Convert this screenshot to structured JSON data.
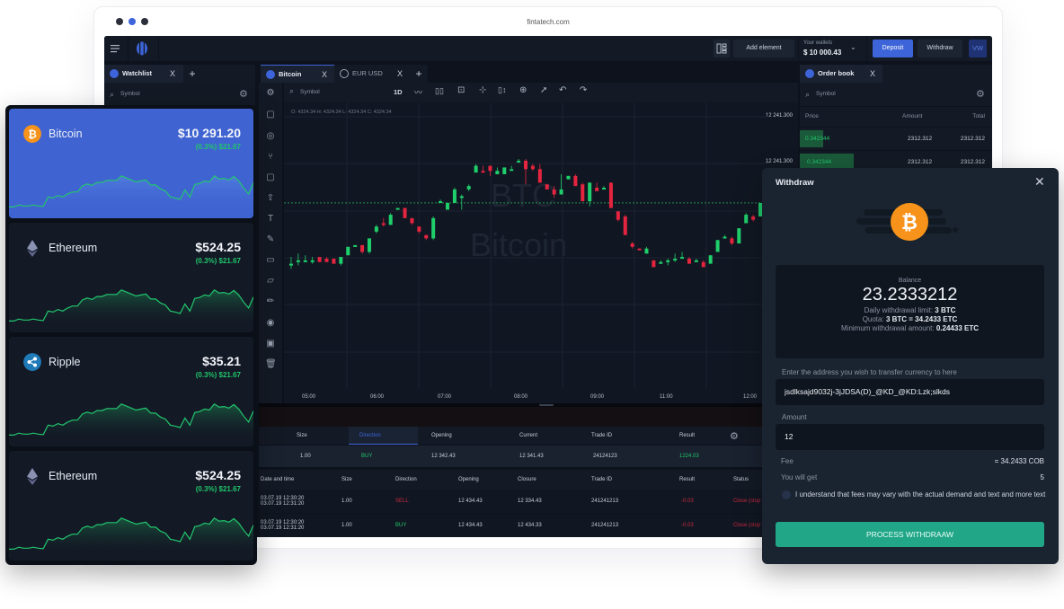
{
  "browser": {
    "url": "fintatech.com",
    "dots": [
      "#2b2f3a",
      "#3d64d8",
      "#2b2f3a"
    ]
  },
  "topbar": {
    "add_element": "Add element",
    "wallet_label": "Your wallets",
    "wallet_value": "$ 10 000.43",
    "deposit": "Deposit",
    "withdraw": "Withdraw",
    "avatar": "VW"
  },
  "watchlist": {
    "tab": "Watchlist",
    "close": "X",
    "add": "+",
    "search_placeholder": "Symbol"
  },
  "chart_tabs": [
    {
      "label": "Bitcoin",
      "close": "X",
      "active": true
    },
    {
      "label": "EUR USD",
      "close": "X",
      "active": false
    }
  ],
  "chart_toolbar": {
    "search_placeholder": "Symbol",
    "interval": "1D"
  },
  "chart": {
    "ohlc": "O: 4324.34   H: 4324.34   L: 4324.34   C: 4324.34",
    "watermark_symbol": "BTC",
    "watermark_name": "Bitcoin",
    "x_ticks": [
      "05:00",
      "06:00",
      "07:00",
      "08:00",
      "09:00",
      "11:00",
      "12:00"
    ],
    "y_ticks": [
      "12 241.300",
      "12 241.300"
    ],
    "colors": {
      "up": "#1fcf6b",
      "down": "#e5243f",
      "bg": "#111722"
    }
  },
  "chart_data": {
    "type": "candlestick",
    "x": [
      "05:00",
      "06:00",
      "07:00",
      "08:00",
      "09:00",
      "11:00",
      "12:00"
    ],
    "candles": [
      [
        0.3,
        0.3,
        0.34,
        0.27
      ],
      [
        0.31,
        0.32,
        0.36,
        0.29
      ],
      [
        0.31,
        0.32,
        0.35,
        0.31
      ],
      [
        0.32,
        0.32,
        0.34,
        0.3
      ],
      [
        0.34,
        0.31,
        0.34,
        0.31
      ],
      [
        0.33,
        0.31,
        0.34,
        0.31
      ],
      [
        0.33,
        0.3,
        0.33,
        0.3
      ],
      [
        0.3,
        0.34,
        0.34,
        0.29
      ],
      [
        0.35,
        0.4,
        0.4,
        0.35
      ],
      [
        0.4,
        0.41,
        0.41,
        0.4
      ],
      [
        0.41,
        0.37,
        0.41,
        0.36
      ],
      [
        0.37,
        0.45,
        0.45,
        0.36
      ],
      [
        0.49,
        0.52,
        0.53,
        0.48
      ],
      [
        0.54,
        0.53,
        0.57,
        0.52
      ],
      [
        0.53,
        0.59,
        0.6,
        0.53
      ],
      [
        0.62,
        0.63,
        0.63,
        0.62
      ],
      [
        0.63,
        0.57,
        0.63,
        0.57
      ],
      [
        0.57,
        0.54,
        0.57,
        0.53
      ],
      [
        0.52,
        0.49,
        0.52,
        0.48
      ],
      [
        0.47,
        0.45,
        0.47,
        0.44
      ],
      [
        0.45,
        0.57,
        0.58,
        0.44
      ],
      [
        0.67,
        0.67,
        0.68,
        0.66
      ],
      [
        0.62,
        0.66,
        0.66,
        0.62
      ],
      [
        0.66,
        0.74,
        0.75,
        0.66
      ],
      [
        0.7,
        0.7,
        0.71,
        0.62
      ],
      [
        0.74,
        0.76,
        0.77,
        0.73
      ],
      [
        0.84,
        0.88,
        0.89,
        0.84
      ],
      [
        0.85,
        0.84,
        0.88,
        0.84
      ],
      [
        0.88,
        0.85,
        0.86,
        0.82
      ],
      [
        0.83,
        0.85,
        0.87,
        0.83
      ],
      [
        0.83,
        0.87,
        0.87,
        0.83
      ],
      [
        0.86,
        0.86,
        0.88,
        0.86
      ],
      [
        0.91,
        0.91,
        0.92,
        0.9
      ],
      [
        0.91,
        0.86,
        0.92,
        0.77
      ],
      [
        0.88,
        0.86,
        0.89,
        0.85
      ],
      [
        0.86,
        0.78,
        0.89,
        0.78
      ],
      [
        0.77,
        0.74,
        0.77,
        0.74
      ],
      [
        0.74,
        0.71,
        0.76,
        0.69
      ],
      [
        0.71,
        0.74,
        0.83,
        0.71
      ],
      [
        0.8,
        0.82,
        0.82,
        0.8
      ],
      [
        0.82,
        0.76,
        0.83,
        0.76
      ],
      [
        0.77,
        0.67,
        0.78,
        0.67
      ],
      [
        0.67,
        0.78,
        0.78,
        0.64
      ],
      [
        0.75,
        0.73,
        0.78,
        0.73
      ],
      [
        0.75,
        0.75,
        0.76,
        0.74
      ],
      [
        0.78,
        0.63,
        0.78,
        0.63
      ],
      [
        0.61,
        0.56,
        0.61,
        0.55
      ],
      [
        0.58,
        0.47,
        0.59,
        0.47
      ],
      [
        0.42,
        0.4,
        0.43,
        0.39
      ],
      [
        0.39,
        0.38,
        0.39,
        0.38
      ],
      [
        0.36,
        0.39,
        0.4,
        0.36
      ],
      [
        0.32,
        0.28,
        0.32,
        0.28
      ],
      [
        0.3,
        0.31,
        0.32,
        0.3
      ],
      [
        0.31,
        0.32,
        0.33,
        0.29
      ],
      [
        0.32,
        0.33,
        0.36,
        0.31
      ],
      [
        0.33,
        0.34,
        0.37,
        0.33
      ],
      [
        0.33,
        0.3,
        0.34,
        0.3
      ],
      [
        0.31,
        0.32,
        0.33,
        0.31
      ],
      [
        0.31,
        0.28,
        0.32,
        0.28
      ],
      [
        0.3,
        0.35,
        0.35,
        0.3
      ],
      [
        0.37,
        0.44,
        0.44,
        0.37
      ],
      [
        0.46,
        0.46,
        0.47,
        0.46
      ],
      [
        0.45,
        0.42,
        0.46,
        0.41
      ],
      [
        0.42,
        0.51,
        0.51,
        0.42
      ],
      [
        0.54,
        0.59,
        0.6,
        0.54
      ],
      [
        0.58,
        0.56,
        0.59,
        0.55
      ],
      [
        0.58,
        0.66,
        0.66,
        0.58
      ]
    ],
    "ylabel": "",
    "xlabel": "",
    "annotations": [
      "BTC",
      "Bitcoin"
    ]
  },
  "tools": [
    "gear-icon",
    "rectangle-icon",
    "target-icon",
    "fork-icon",
    "square-icon",
    "arrow-up-icon",
    "text-icon",
    "brush-icon",
    "comment-icon",
    "ruler-icon",
    "pencil-icon",
    "eye-off-icon",
    "camera-icon",
    "trash-icon"
  ],
  "toolbar_icons": [
    "line-chart-icon",
    "candles-icon",
    "indicator-icon",
    "crosshair-icon",
    "scale-icon",
    "zoom-in-icon",
    "cursor-icon",
    "undo-icon",
    "redo-icon"
  ],
  "positions": {
    "headers": [
      "Size",
      "Direction",
      "Opening",
      "Current",
      "Trade ID",
      "Result"
    ],
    "row": {
      "size": "1.00",
      "direction": "BUY",
      "opening": "12 342.43",
      "current": "12 341.43",
      "trade_id": "24124123",
      "result": "1224.03"
    }
  },
  "history": {
    "headers": [
      "Date and time",
      "Size",
      "Direction",
      "Opening",
      "Closure",
      "Trade ID",
      "Result",
      "Status"
    ],
    "rows": [
      {
        "date1": "03.07.19 12:30:20",
        "date2": "03.07.19 12:31:20",
        "size": "1.00",
        "direction": "SELL",
        "opening": "12 434.43",
        "closure": "12 334.43",
        "trade_id": "241241213",
        "result": "-0.03",
        "status": "Close (stop o"
      },
      {
        "date1": "03.07.19 12:30:20",
        "date2": "03.07.19 12:31:20",
        "size": "1.00",
        "direction": "BUY",
        "opening": "12 434.43",
        "closure": "12 434.33",
        "trade_id": "241241213",
        "result": "-0.03",
        "status": "Close (stop o"
      }
    ]
  },
  "orderbook": {
    "tab": "Order book",
    "close": "X",
    "search_placeholder": "Symbol",
    "headers": [
      "Price",
      "Amount",
      "Total"
    ],
    "rows": [
      {
        "price": "0.342344",
        "amount": "2312.312",
        "total": "2312.312",
        "depth": 0.12
      },
      {
        "price": "0.342344",
        "amount": "2312.312",
        "total": "2312.312",
        "depth": 0.28
      }
    ]
  },
  "cards": [
    {
      "name": "Bitcoin",
      "price": "$10 291.20",
      "change": "(0.3%) $21.67",
      "icon": "bitcoin-icon",
      "active": true
    },
    {
      "name": "Ethereum",
      "price": "$524.25",
      "change": "(0.3%) $21.67",
      "icon": "ethereum-icon",
      "active": false
    },
    {
      "name": "Ripple",
      "price": "$35.21",
      "change": "(0.3%) $21.67",
      "icon": "ripple-icon",
      "active": false
    },
    {
      "name": "Ethereum",
      "price": "$524.25",
      "change": "(0.3%) $21.67",
      "icon": "ethereum-icon",
      "active": false
    }
  ],
  "sparkline": [
    0.1,
    0.1,
    0.14,
    0.12,
    0.12,
    0.14,
    0.12,
    0.11,
    0.3,
    0.28,
    0.33,
    0.3,
    0.36,
    0.4,
    0.4,
    0.52,
    0.56,
    0.53,
    0.59,
    0.59,
    0.63,
    0.63,
    0.63,
    0.72,
    0.68,
    0.64,
    0.6,
    0.62,
    0.64,
    0.54,
    0.54,
    0.46,
    0.42,
    0.3,
    0.28,
    0.25,
    0.44,
    0.3,
    0.55,
    0.57,
    0.62,
    0.6,
    0.72,
    0.66,
    0.67,
    0.64,
    0.71,
    0.62,
    0.48,
    0.36,
    0.58
  ],
  "withdraw": {
    "title": "Withdraw",
    "balance_label": "Balance",
    "balance": "23.2333212",
    "limit_label": "Daily withdrawal limit:",
    "limit_value": "3 BTC",
    "quota_label": "Quota:",
    "quota_value": "3 BTC = 34.2433 ETC",
    "min_label": "Minimum withdrawal amount:",
    "min_value": "0.24433 ETC",
    "address_label": "Enter the address you wish to transfer currency to here",
    "address_value": "jsdlksajd9032j-3jJDSA(D)_@KD_@KD:Lzk;slkds",
    "amount_label": "Amount",
    "amount_value": "12",
    "fee_label": "Fee",
    "fee_value": "= 34.2433 COB",
    "get_label": "You will get",
    "get_value": "5",
    "agree_text": "I understand that fees may vary with the actual demand and text and more text",
    "agree_checked": false,
    "submit": "PROCESS WITHDRAAW"
  }
}
